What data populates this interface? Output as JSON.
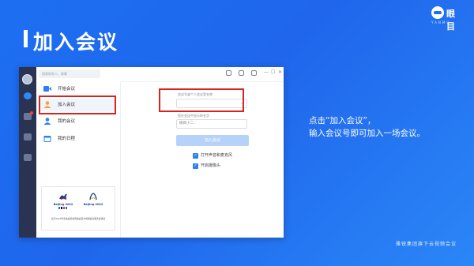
{
  "slide": {
    "title": "加入会议",
    "brand": {
      "name": "眼目",
      "sub": "YANMU"
    },
    "description": [
      "点击“加入会议”，",
      "输入会议号即可加入一场会议。"
    ],
    "footer": "雅锐集团旗下云视频会议"
  },
  "app": {
    "search_placeholder": "搜索联系人、群聊",
    "window_controls": [
      "—",
      "☐",
      "✕"
    ],
    "nav": [
      {
        "label": "开始会议",
        "icon": "video-camera-icon"
      },
      {
        "label": "加入会议",
        "icon": "user-add-icon"
      },
      {
        "label": "我的会议",
        "icon": "user-icon"
      },
      {
        "label": "我的日程",
        "icon": "calendar-icon"
      }
    ],
    "qr_card": {
      "emblem_left_text": "Beijing 2022",
      "emblem_right_text": "Beijing 2022",
      "caption": "北京2022年冬奥会和冬残奥会官方视频会议服务提供商"
    },
    "form": {
      "meeting_id_label": "会议号或个人会议室名称",
      "meeting_id_value": "",
      "name_label": "您在会议中显示的名字",
      "name_value": "眼目小二",
      "join_button": "加入会议",
      "option_mic": "打开声音和麦克风",
      "option_camera": "开启摄像头"
    }
  },
  "colors": {
    "background": "#1f66ec",
    "accent": "#2b7ff3",
    "highlight": "#d8231f",
    "rail": "#2a3452"
  }
}
